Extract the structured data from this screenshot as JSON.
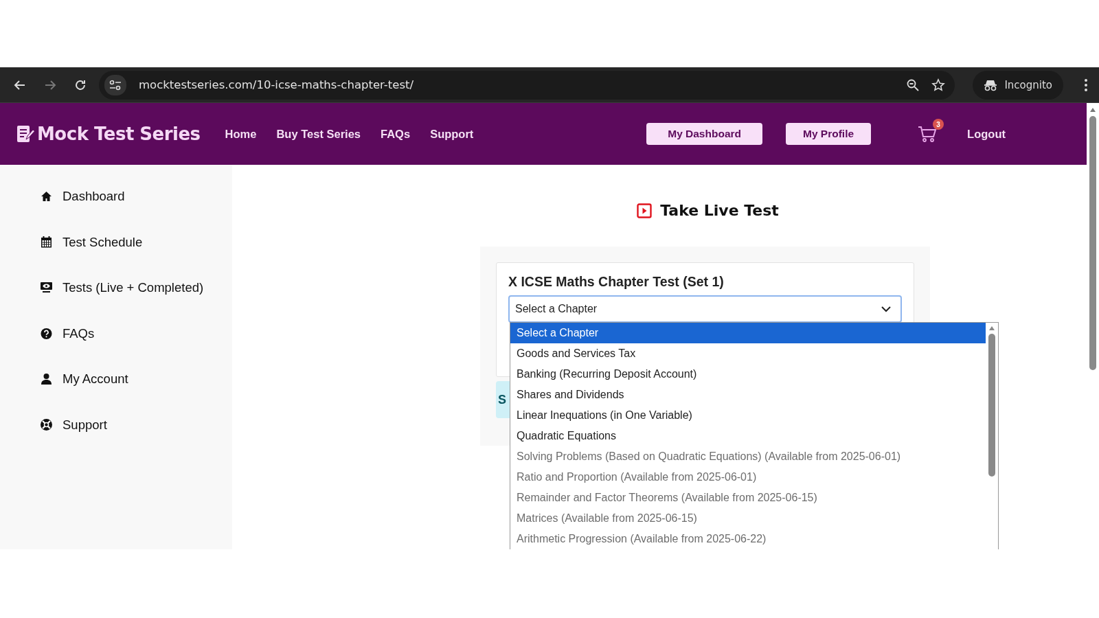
{
  "browser": {
    "url": "mocktestseries.com/10-icse-maths-chapter-test/",
    "profile": "Incognito"
  },
  "header": {
    "logo": "Mock Test Series",
    "nav": [
      {
        "label": "Home"
      },
      {
        "label": "Buy Test Series"
      },
      {
        "label": "FAQs"
      },
      {
        "label": "Support"
      }
    ],
    "buttons": [
      "My Dashboard",
      "My Profile"
    ],
    "cart_count": "3",
    "logout": "Logout"
  },
  "sidebar": {
    "items": [
      {
        "label": "Dashboard",
        "kind": "home"
      },
      {
        "label": "Test Schedule",
        "kind": "calendar"
      },
      {
        "label": "Tests (Live + Completed)",
        "kind": "monitor"
      },
      {
        "label": "FAQs",
        "kind": "question"
      },
      {
        "label": "My Account",
        "kind": "user"
      },
      {
        "label": "Support",
        "kind": "lifebuoy"
      }
    ]
  },
  "main": {
    "title": "Take Live Test",
    "card_title": "X ICSE Maths Chapter Test (Set 1)",
    "select_value": "Select a Chapter",
    "hidden_button": "S"
  },
  "dropdown": {
    "options": [
      {
        "label": "Select a Chapter",
        "selected": true,
        "disabled": false
      },
      {
        "label": "Goods and Services Tax",
        "selected": false,
        "disabled": false
      },
      {
        "label": "Banking (Recurring Deposit Account)",
        "selected": false,
        "disabled": false
      },
      {
        "label": "Shares and Dividends",
        "selected": false,
        "disabled": false
      },
      {
        "label": "Linear Inequations (in One Variable)",
        "selected": false,
        "disabled": false
      },
      {
        "label": "Quadratic Equations",
        "selected": false,
        "disabled": false
      },
      {
        "label": "Solving Problems (Based on Quadratic Equations) (Available from 2025-06-01)",
        "selected": false,
        "disabled": true
      },
      {
        "label": "Ratio and Proportion (Available from 2025-06-01)",
        "selected": false,
        "disabled": true
      },
      {
        "label": "Remainder and Factor Theorems (Available from 2025-06-15)",
        "selected": false,
        "disabled": true
      },
      {
        "label": "Matrices (Available from 2025-06-15)",
        "selected": false,
        "disabled": true
      },
      {
        "label": "Arithmetic Progression (Available from 2025-06-22)",
        "selected": false,
        "disabled": true
      }
    ]
  }
}
